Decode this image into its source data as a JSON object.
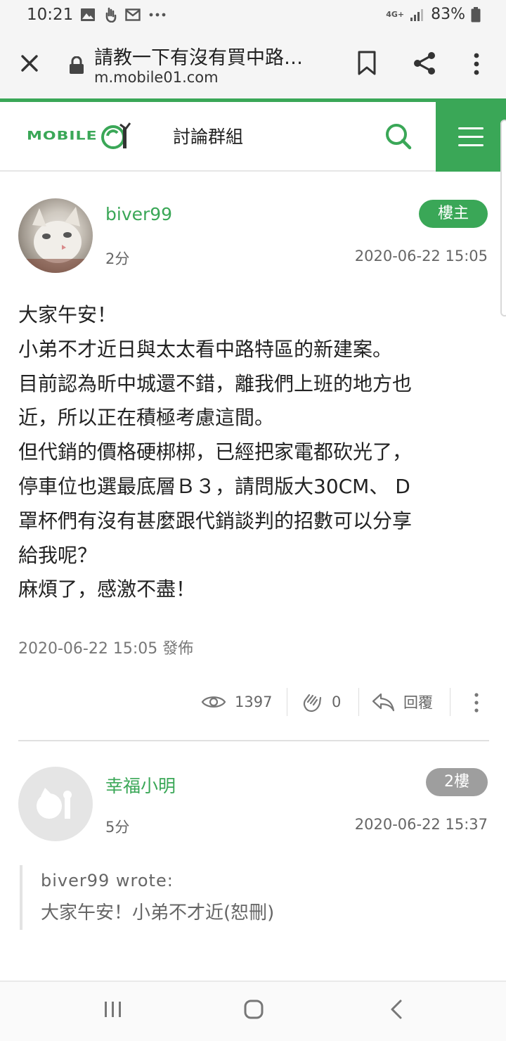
{
  "status_bar": {
    "time": "10:21",
    "left_icons": [
      "image-icon",
      "hand-icon",
      "mail-icon",
      "more-dots-icon"
    ],
    "network": "4G+",
    "battery": "83%"
  },
  "browser": {
    "page_title": "請教一下有沒有買中路…",
    "host": "m.mobile01.com"
  },
  "site": {
    "logo_text": "MOBILE",
    "section": "討論群組",
    "brand_color": "#3aa757"
  },
  "post1": {
    "author": "biver99",
    "badge": "樓主",
    "age": "2分",
    "timestamp": "2020-06-22 15:05",
    "body_lines": [
      "大家午安！",
      "小弟不才近日與太太看中路特區的新建案。",
      "目前認為昕中城還不錯，離我們上班的地方也",
      "近，所以正在積極考慮這間。",
      "但代銷的價格硬梆梆，已經把家電都砍光了，",
      "停車位也選最底層Ｂ３，請問版大30CM、 D",
      "罩杯們有沒有甚麼跟代銷談判的招數可以分享",
      "給我呢？",
      "麻煩了，感激不盡！"
    ],
    "posted": "2020-06-22 15:05 發佈",
    "views": "1397",
    "likes": "0",
    "reply_label": "回覆"
  },
  "post2": {
    "author": "幸福小明",
    "badge": "2樓",
    "age": "5分",
    "timestamp": "2020-06-22 15:37",
    "quote_author": "biver99 wrote:",
    "quote_text": "大家午安！小弟不才近(恕刪)"
  }
}
